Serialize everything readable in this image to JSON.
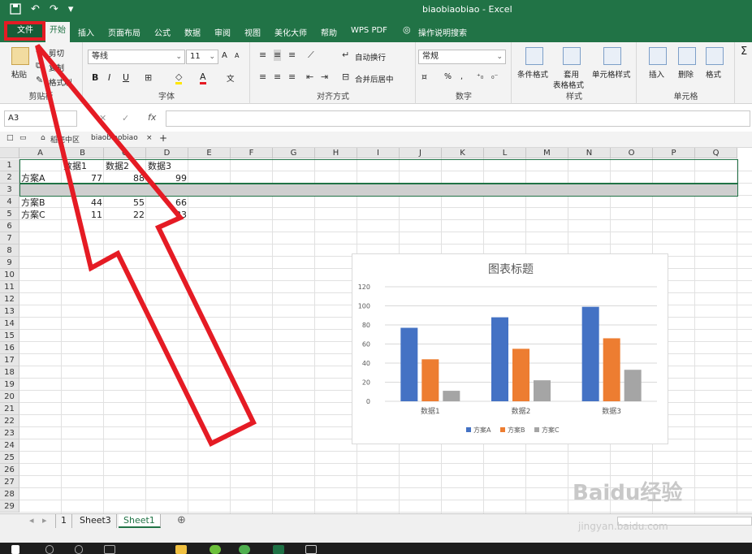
{
  "window": {
    "title": "biaobiaobiao - Excel"
  },
  "qat": {
    "save_icon": "save-icon",
    "undo": "↶",
    "redo": "↷",
    "more": "▾"
  },
  "tabs": [
    "文件",
    "开始",
    "插入",
    "页面布局",
    "公式",
    "数据",
    "审阅",
    "视图",
    "美化大师",
    "帮助",
    "WPS PDF",
    "操作说明搜索"
  ],
  "ribbon": {
    "clipboard": {
      "paste": "粘贴",
      "cut": "剪切",
      "copy": "复制",
      "format_painter": "格式刷",
      "label": "剪贴板"
    },
    "font": {
      "name": "等线",
      "size": "11",
      "bold": "B",
      "italic": "I",
      "underline": "U",
      "grow": "A",
      "shrink": "A",
      "color_a": "A",
      "phonetic": "文",
      "label": "字体"
    },
    "align": {
      "wrap": "自动换行",
      "merge": "合并后居中",
      "label": "对齐方式"
    },
    "number": {
      "format": "常规",
      "percent": "%",
      "comma": ",",
      "label": "数字"
    },
    "styles": {
      "cond": "条件格式",
      "table1": "套用",
      "table2": "表格格式",
      "cell": "单元格样式",
      "label": "样式"
    },
    "cells": {
      "insert": "插入",
      "delete": "删除",
      "format": "格式",
      "label": "单元格"
    },
    "sum": "Σ"
  },
  "formula_bar": {
    "name_box": "A3",
    "fx": "fx",
    "cancel": "✕",
    "enter": "✓",
    "value": ""
  },
  "doc_tabs": {
    "tab1": "稻壳中区",
    "tab2": "biaobiaobiao",
    "close": "×",
    "add": "+"
  },
  "columns": [
    "A",
    "B",
    "C",
    "D",
    "E",
    "F",
    "G",
    "H",
    "I",
    "J",
    "K",
    "L",
    "M",
    "N",
    "O",
    "P",
    "Q"
  ],
  "rows": [
    "1",
    "2",
    "3",
    "4",
    "5",
    "6",
    "7",
    "8",
    "9",
    "10",
    "11",
    "12",
    "13",
    "14",
    "15",
    "16",
    "17",
    "18",
    "19",
    "20",
    "21",
    "22",
    "23",
    "24",
    "25",
    "26",
    "27",
    "28",
    "29"
  ],
  "cells": {
    "B1": "数据1",
    "C1": "数据2",
    "D1": "数据3",
    "A2": "方案A",
    "B2": "77",
    "C2": "88",
    "D2": "99",
    "A4": "方案B",
    "B4": "44",
    "C4": "55",
    "D4": "66",
    "A5": "方案C",
    "B5": "11",
    "C5": "22",
    "D5": "33"
  },
  "chart_data": {
    "type": "bar",
    "title": "图表标题",
    "categories": [
      "数据1",
      "数据2",
      "数据3"
    ],
    "series": [
      {
        "name": "方案A",
        "values": [
          77,
          88,
          99
        ],
        "color": "#4472c4"
      },
      {
        "name": "方案B",
        "values": [
          44,
          55,
          66
        ],
        "color": "#ed7d31"
      },
      {
        "name": "方案C",
        "values": [
          11,
          22,
          33
        ],
        "color": "#a5a5a5"
      }
    ],
    "ylim": [
      0,
      120
    ],
    "yticks": [
      0,
      20,
      40,
      60,
      80,
      100,
      120
    ],
    "grid": true,
    "legend": "bottom",
    "xlabel": "",
    "ylabel": ""
  },
  "sheets": {
    "nav_prev": "◂",
    "nav_next": "▸",
    "tab_1": "1",
    "tab_sheet3": "Sheet3",
    "tab_sheet1": "Sheet1",
    "add": "⊕"
  },
  "watermark": {
    "brand": "Baidu经验",
    "url": "jingyan.baidu.com"
  },
  "accent_color": "#217346",
  "annotation_color": "#e51b24"
}
